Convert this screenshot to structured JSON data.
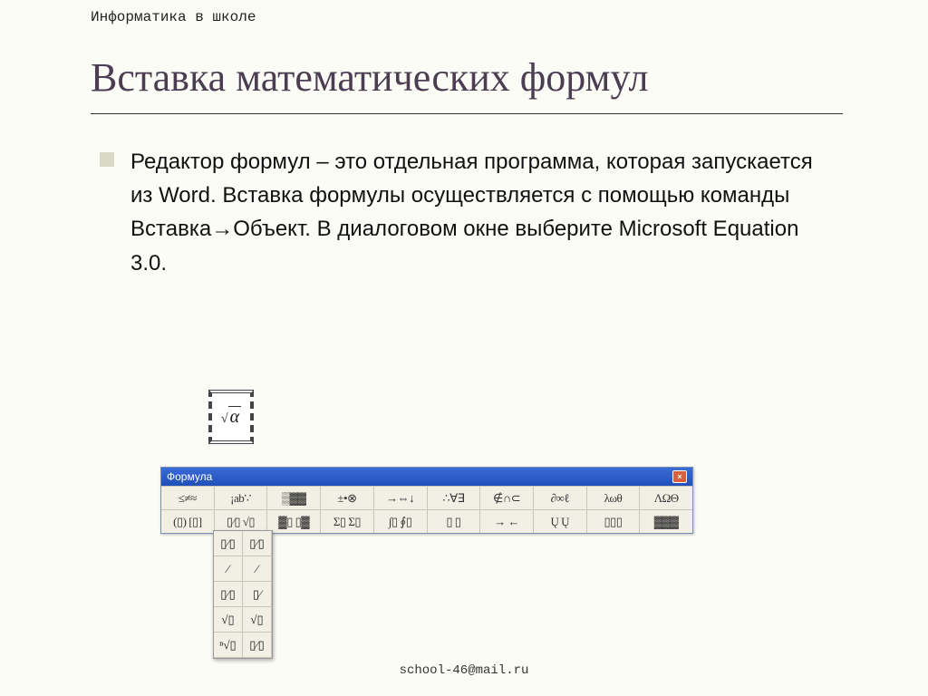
{
  "header": "Информатика в школе",
  "title": "Вставка математических формул",
  "body": "Редактор формул – это отдельная программа, которая запускается из Word. Вставка формулы осуществляется с помощью команды Вставка→Объект. В диалоговом окне выберите Microsoft Equation 3.0.",
  "equation_sample": "√α",
  "toolbar": {
    "title": "Формула",
    "close": "×",
    "row1": [
      "≤≠≈",
      "¡ab∵",
      "▒▓▓",
      "±•⊗",
      "→⇔↓",
      "∴∀∃",
      "∉∩⊂",
      "∂∞ℓ",
      "λωθ",
      "ΛΩΘ"
    ],
    "row2": [
      "(▯) [▯]",
      "▯⁄▯ √▯",
      "▓▯ ▯▓",
      "Σ▯ Σ▯",
      "∫▯ ∮▯",
      "▯ ▯",
      "→ ←",
      "Ų Ų",
      "▯▯▯",
      "▓▓▓"
    ]
  },
  "dropdown": [
    "▯⁄▯",
    "▯⁄▯",
    "⁄",
    "⁄",
    "▯⁄▯",
    "▯⁄",
    "√▯",
    "√▯",
    "ⁿ√▯",
    "▯⁄▯"
  ],
  "footer": "school-46@mail.ru"
}
